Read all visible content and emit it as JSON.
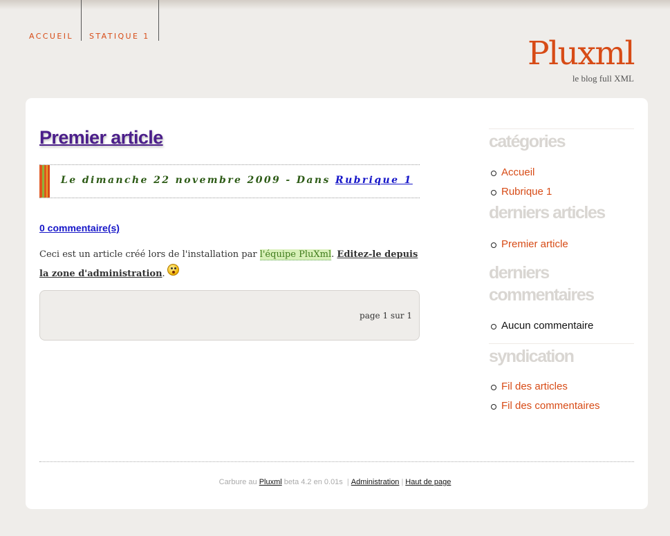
{
  "nav": {
    "items": [
      {
        "label": "ACCUEIL"
      },
      {
        "label": "STATIQUE 1"
      }
    ]
  },
  "header": {
    "title": "Pluxml",
    "description": "le blog full XML"
  },
  "article": {
    "title": "Premier article",
    "meta_prefix": "Le dimanche 22 novembre 2009 - Dans ",
    "category": "Rubrique 1",
    "comments_link": "0 commentaire(s)",
    "body_prefix": "Ceci est un article créé lors de l'installation par ",
    "team_link": "l'équipe PluXml",
    "body_mid": ". ",
    "admin_link": "Editez-le depuis la zone d'administration",
    "body_suffix": "."
  },
  "pagination": {
    "text": "page 1 sur 1"
  },
  "sidebar": {
    "categories": {
      "title": "catégories",
      "items": [
        "Accueil",
        "Rubrique 1"
      ]
    },
    "recent_articles": {
      "title": "derniers articles",
      "items": [
        "Premier article"
      ]
    },
    "recent_comments": {
      "title": "derniers commentaires",
      "items": [
        "Aucun commentaire"
      ]
    },
    "syndication": {
      "title": "syndication",
      "items": [
        "Fil des articles",
        "Fil des commentaires"
      ]
    }
  },
  "footer": {
    "powered_prefix": "Carbure au ",
    "pluxml_link": "Pluxml",
    "version": " beta 4.2 en 0.01s ",
    "admin_link": "Administration",
    "top_link": "Haut de page"
  },
  "colors": {
    "accent": "#d74b16",
    "background": "#efedea",
    "title_purple": "#4b1e8a",
    "link_blue": "#1515c8"
  }
}
